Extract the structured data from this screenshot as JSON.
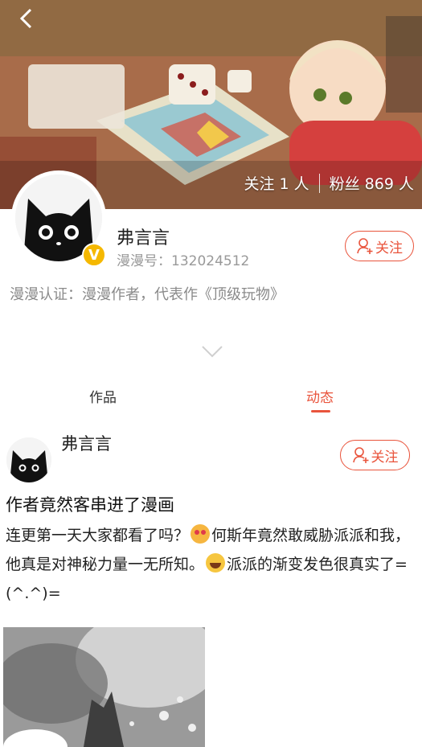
{
  "header": {
    "back_icon": "chevron-left-icon",
    "following_label": "关注 1 人",
    "fans_label": "粉丝 869 人"
  },
  "profile": {
    "name": "弗言言",
    "id_label": "漫漫号：132024512",
    "verified_badge": "V",
    "follow_label": "关注",
    "certification": "漫漫认证：漫漫作者，代表作《顶级玩物》",
    "accent_color": "#e9543c",
    "badge_color": "#f5b800"
  },
  "tabs": [
    {
      "label": "作品",
      "active": false
    },
    {
      "label": "动态",
      "active": true
    }
  ],
  "post": {
    "author": "弗言言",
    "follow_label": "关注",
    "title": "作者竟然客串进了漫画",
    "body_part1": "连更第一天大家都看了吗？",
    "body_part2": "何斯年竟然敢威胁派派和我，他真是对神秘力量一无所知。",
    "body_part3": "派派的渐变发色很真实了=(^.^)="
  }
}
